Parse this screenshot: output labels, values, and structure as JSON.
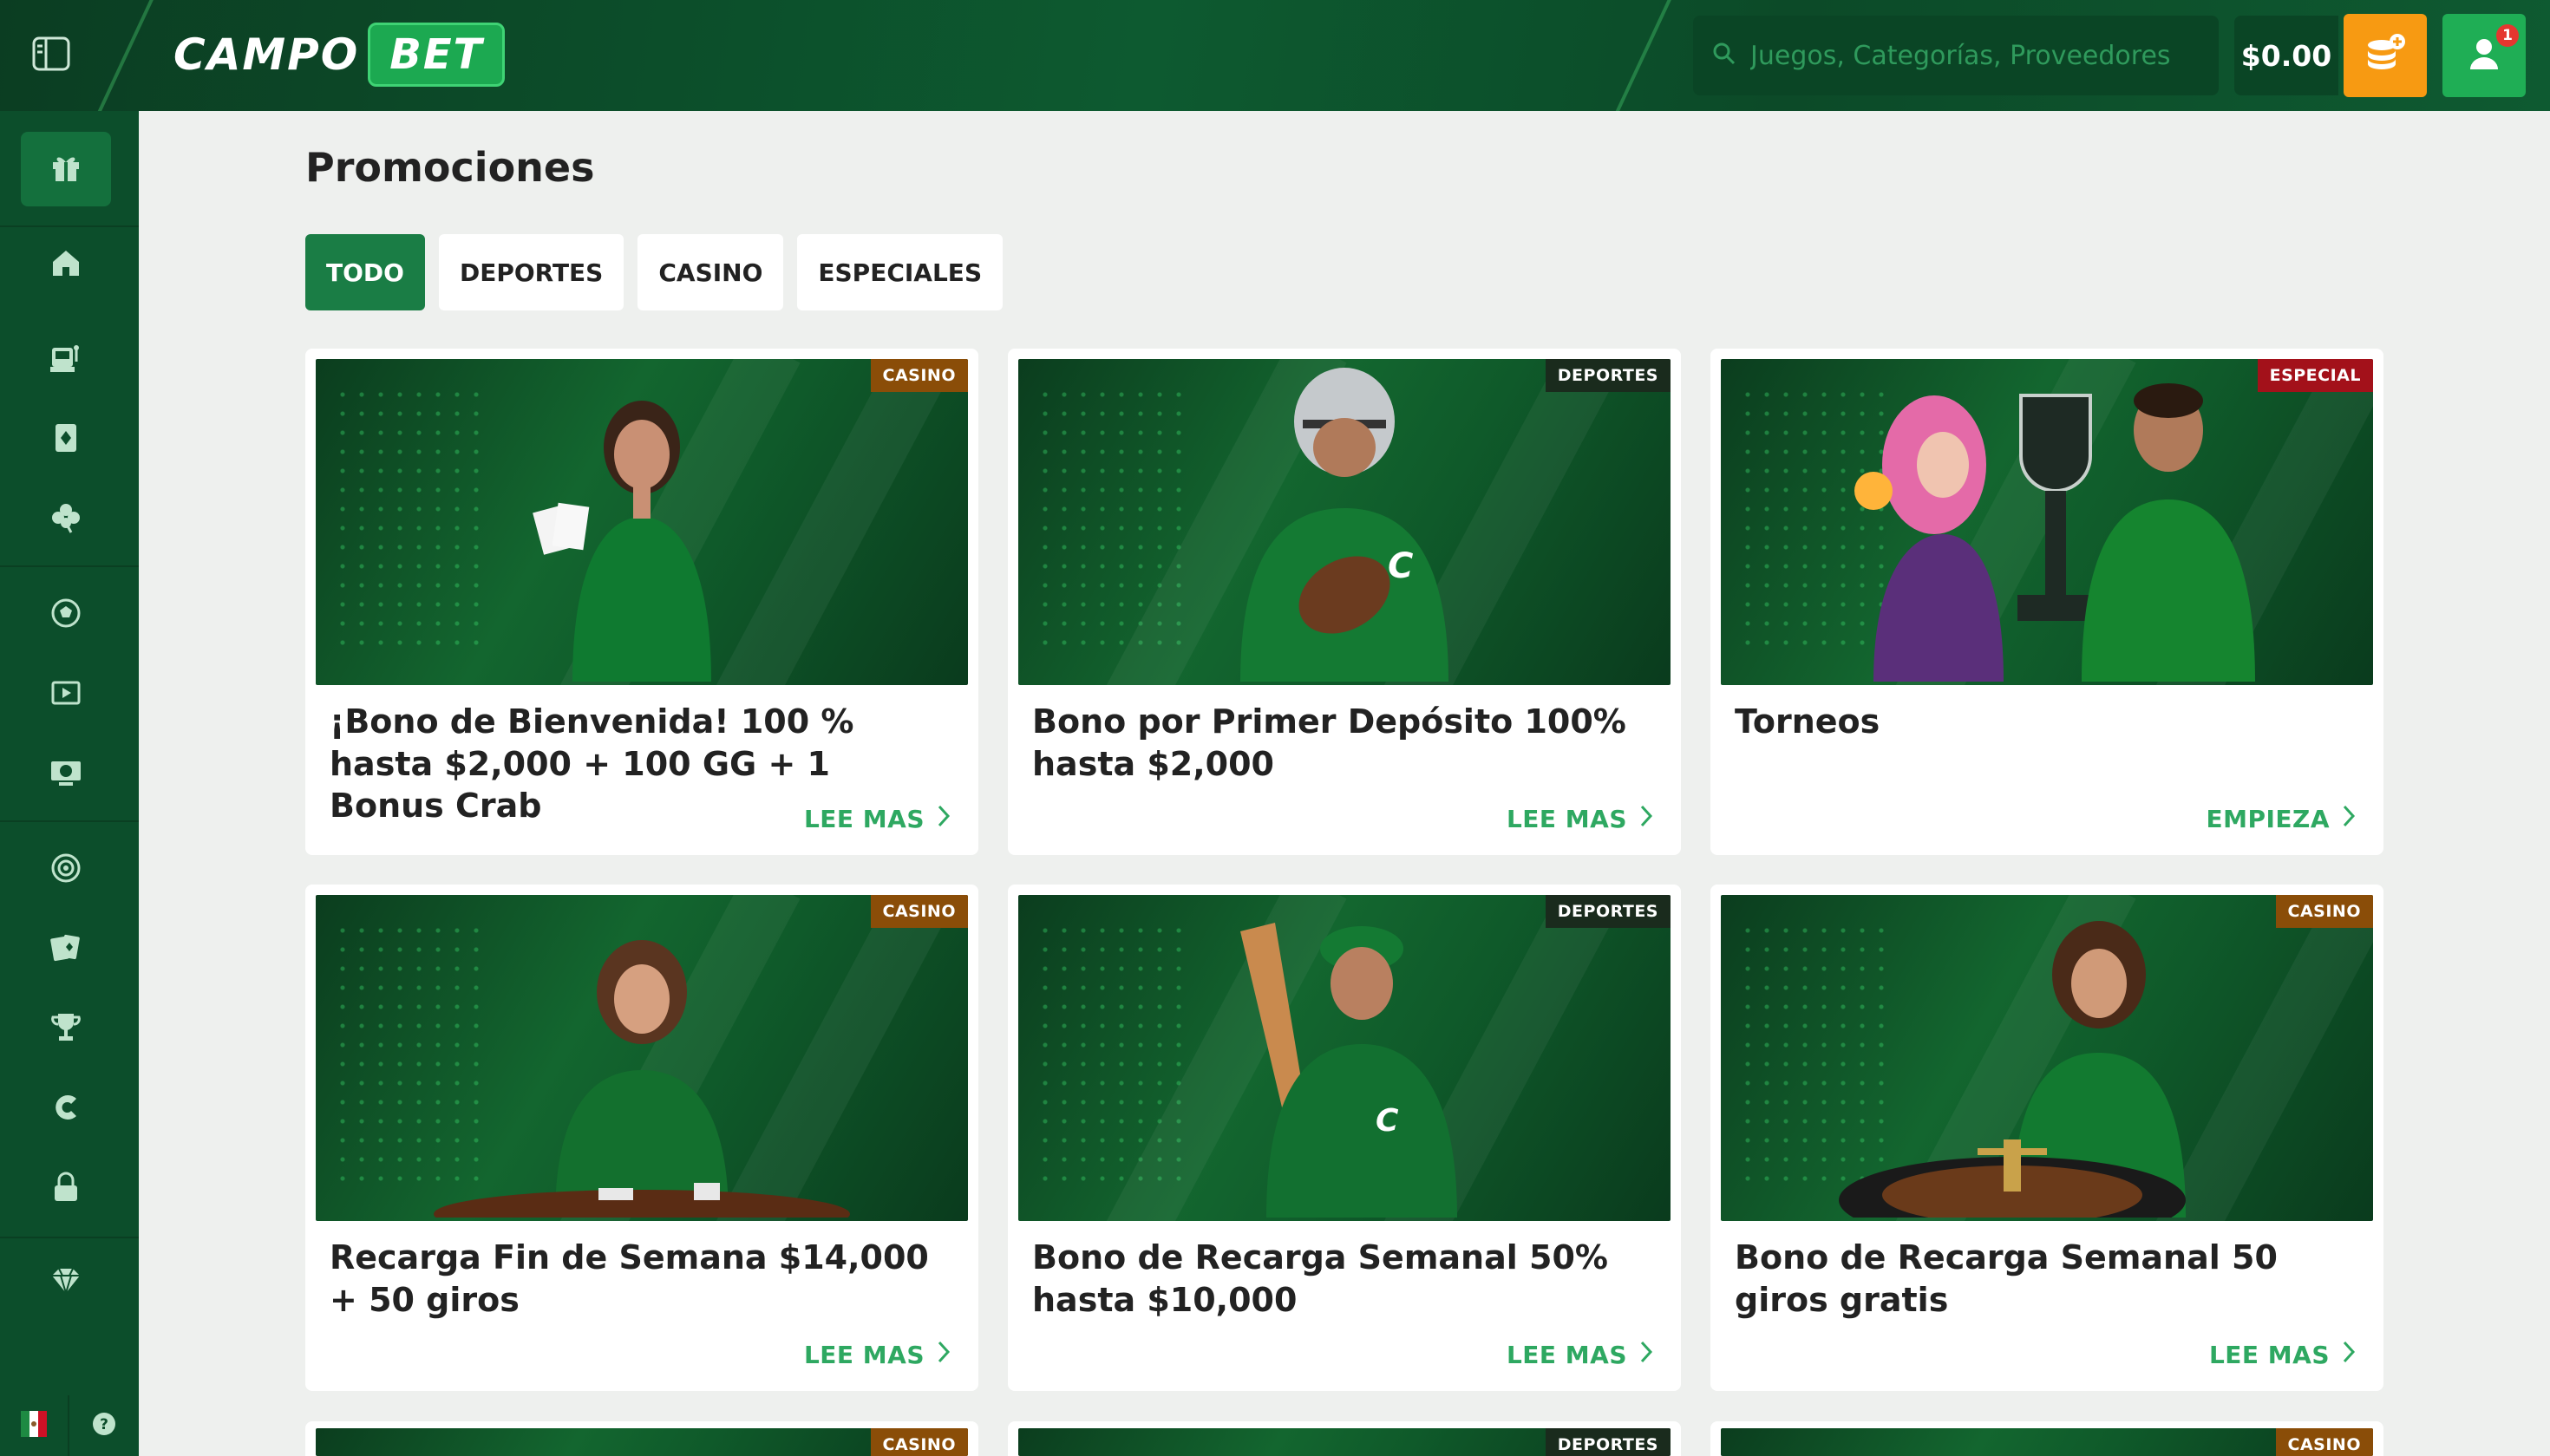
{
  "header": {
    "logo_left": "CAMPO",
    "logo_right": "BET",
    "search_placeholder": "Juegos, Categorías, Proveedores",
    "balance": "$0.00",
    "notification_count": "1"
  },
  "page": {
    "title": "Promociones"
  },
  "tabs": [
    {
      "label": "TODO",
      "active": true
    },
    {
      "label": "DEPORTES",
      "active": false
    },
    {
      "label": "CASINO",
      "active": false
    },
    {
      "label": "ESPECIALES",
      "active": false
    }
  ],
  "sidebar": {
    "items": [
      {
        "icon": "gift-icon",
        "active": true
      },
      {
        "icon": "home-icon"
      },
      {
        "icon": "slot-machine-icon"
      },
      {
        "icon": "card-icon"
      },
      {
        "icon": "clover-icon"
      },
      {
        "icon": "soccer-ball-icon"
      },
      {
        "icon": "play-icon"
      },
      {
        "icon": "live-soccer-icon"
      },
      {
        "icon": "target-icon"
      },
      {
        "icon": "cards-icon"
      },
      {
        "icon": "trophy-icon"
      },
      {
        "icon": "campo-logo-icon"
      },
      {
        "icon": "lock-icon"
      },
      {
        "icon": "diamond-icon"
      }
    ]
  },
  "promotions": [
    {
      "tag": "CASINO",
      "title": "¡Bono de Bienvenida! 100 % hasta $2,000 + 100 GG + 1 Bonus Crab",
      "cta": "LEE MAS"
    },
    {
      "tag": "DEPORTES",
      "title": "Bono por Primer Depósito 100% hasta $2,000",
      "cta": "LEE MAS"
    },
    {
      "tag": "ESPECIAL",
      "title": "Torneos",
      "cta": "EMPIEZA"
    },
    {
      "tag": "CASINO",
      "title": "Recarga Fin de Semana $14,000 + 50 giros",
      "cta": "LEE MAS"
    },
    {
      "tag": "DEPORTES",
      "title": "Bono de Recarga Semanal 50% hasta $10,000",
      "cta": "LEE MAS"
    },
    {
      "tag": "CASINO",
      "title": "Bono de Recarga Semanal 50 giros gratis",
      "cta": "LEE MAS"
    },
    {
      "tag": "CASINO"
    },
    {
      "tag": "DEPORTES"
    },
    {
      "tag": "CASINO"
    }
  ],
  "colors": {
    "header_bg": "#0d5a30",
    "sidebar_bg": "#0c4e2b",
    "accent_green": "#1a7d45",
    "link_green": "#2ea861",
    "deposit_orange": "#f79a12",
    "tag_casino": "#8a4d08",
    "tag_deportes": "#1a2b1d",
    "tag_especial": "#a3111a"
  }
}
